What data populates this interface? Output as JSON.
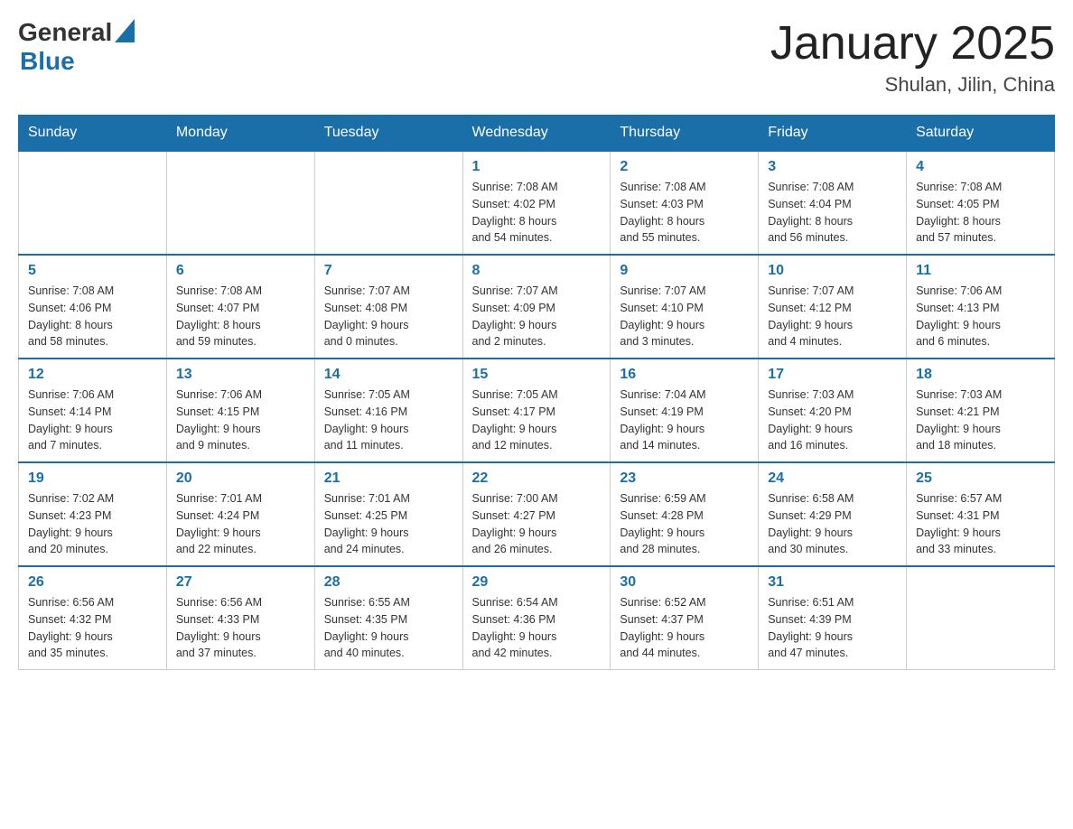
{
  "header": {
    "logo_general": "General",
    "logo_blue": "Blue",
    "month_title": "January 2025",
    "location": "Shulan, Jilin, China"
  },
  "days_of_week": [
    "Sunday",
    "Monday",
    "Tuesday",
    "Wednesday",
    "Thursday",
    "Friday",
    "Saturday"
  ],
  "weeks": [
    [
      {
        "day": "",
        "info": ""
      },
      {
        "day": "",
        "info": ""
      },
      {
        "day": "",
        "info": ""
      },
      {
        "day": "1",
        "info": "Sunrise: 7:08 AM\nSunset: 4:02 PM\nDaylight: 8 hours\nand 54 minutes."
      },
      {
        "day": "2",
        "info": "Sunrise: 7:08 AM\nSunset: 4:03 PM\nDaylight: 8 hours\nand 55 minutes."
      },
      {
        "day": "3",
        "info": "Sunrise: 7:08 AM\nSunset: 4:04 PM\nDaylight: 8 hours\nand 56 minutes."
      },
      {
        "day": "4",
        "info": "Sunrise: 7:08 AM\nSunset: 4:05 PM\nDaylight: 8 hours\nand 57 minutes."
      }
    ],
    [
      {
        "day": "5",
        "info": "Sunrise: 7:08 AM\nSunset: 4:06 PM\nDaylight: 8 hours\nand 58 minutes."
      },
      {
        "day": "6",
        "info": "Sunrise: 7:08 AM\nSunset: 4:07 PM\nDaylight: 8 hours\nand 59 minutes."
      },
      {
        "day": "7",
        "info": "Sunrise: 7:07 AM\nSunset: 4:08 PM\nDaylight: 9 hours\nand 0 minutes."
      },
      {
        "day": "8",
        "info": "Sunrise: 7:07 AM\nSunset: 4:09 PM\nDaylight: 9 hours\nand 2 minutes."
      },
      {
        "day": "9",
        "info": "Sunrise: 7:07 AM\nSunset: 4:10 PM\nDaylight: 9 hours\nand 3 minutes."
      },
      {
        "day": "10",
        "info": "Sunrise: 7:07 AM\nSunset: 4:12 PM\nDaylight: 9 hours\nand 4 minutes."
      },
      {
        "day": "11",
        "info": "Sunrise: 7:06 AM\nSunset: 4:13 PM\nDaylight: 9 hours\nand 6 minutes."
      }
    ],
    [
      {
        "day": "12",
        "info": "Sunrise: 7:06 AM\nSunset: 4:14 PM\nDaylight: 9 hours\nand 7 minutes."
      },
      {
        "day": "13",
        "info": "Sunrise: 7:06 AM\nSunset: 4:15 PM\nDaylight: 9 hours\nand 9 minutes."
      },
      {
        "day": "14",
        "info": "Sunrise: 7:05 AM\nSunset: 4:16 PM\nDaylight: 9 hours\nand 11 minutes."
      },
      {
        "day": "15",
        "info": "Sunrise: 7:05 AM\nSunset: 4:17 PM\nDaylight: 9 hours\nand 12 minutes."
      },
      {
        "day": "16",
        "info": "Sunrise: 7:04 AM\nSunset: 4:19 PM\nDaylight: 9 hours\nand 14 minutes."
      },
      {
        "day": "17",
        "info": "Sunrise: 7:03 AM\nSunset: 4:20 PM\nDaylight: 9 hours\nand 16 minutes."
      },
      {
        "day": "18",
        "info": "Sunrise: 7:03 AM\nSunset: 4:21 PM\nDaylight: 9 hours\nand 18 minutes."
      }
    ],
    [
      {
        "day": "19",
        "info": "Sunrise: 7:02 AM\nSunset: 4:23 PM\nDaylight: 9 hours\nand 20 minutes."
      },
      {
        "day": "20",
        "info": "Sunrise: 7:01 AM\nSunset: 4:24 PM\nDaylight: 9 hours\nand 22 minutes."
      },
      {
        "day": "21",
        "info": "Sunrise: 7:01 AM\nSunset: 4:25 PM\nDaylight: 9 hours\nand 24 minutes."
      },
      {
        "day": "22",
        "info": "Sunrise: 7:00 AM\nSunset: 4:27 PM\nDaylight: 9 hours\nand 26 minutes."
      },
      {
        "day": "23",
        "info": "Sunrise: 6:59 AM\nSunset: 4:28 PM\nDaylight: 9 hours\nand 28 minutes."
      },
      {
        "day": "24",
        "info": "Sunrise: 6:58 AM\nSunset: 4:29 PM\nDaylight: 9 hours\nand 30 minutes."
      },
      {
        "day": "25",
        "info": "Sunrise: 6:57 AM\nSunset: 4:31 PM\nDaylight: 9 hours\nand 33 minutes."
      }
    ],
    [
      {
        "day": "26",
        "info": "Sunrise: 6:56 AM\nSunset: 4:32 PM\nDaylight: 9 hours\nand 35 minutes."
      },
      {
        "day": "27",
        "info": "Sunrise: 6:56 AM\nSunset: 4:33 PM\nDaylight: 9 hours\nand 37 minutes."
      },
      {
        "day": "28",
        "info": "Sunrise: 6:55 AM\nSunset: 4:35 PM\nDaylight: 9 hours\nand 40 minutes."
      },
      {
        "day": "29",
        "info": "Sunrise: 6:54 AM\nSunset: 4:36 PM\nDaylight: 9 hours\nand 42 minutes."
      },
      {
        "day": "30",
        "info": "Sunrise: 6:52 AM\nSunset: 4:37 PM\nDaylight: 9 hours\nand 44 minutes."
      },
      {
        "day": "31",
        "info": "Sunrise: 6:51 AM\nSunset: 4:39 PM\nDaylight: 9 hours\nand 47 minutes."
      },
      {
        "day": "",
        "info": ""
      }
    ]
  ]
}
